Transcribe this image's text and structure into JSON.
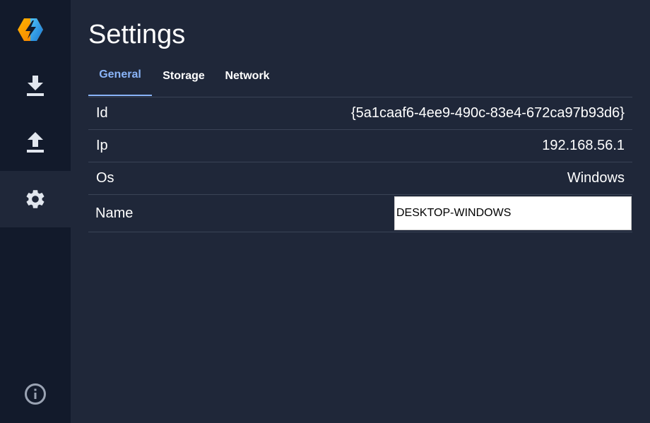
{
  "sidebar": {
    "logo": "lightning-bolt-logo",
    "items": [
      {
        "name": "download",
        "icon": "download-icon"
      },
      {
        "name": "upload",
        "icon": "upload-icon"
      },
      {
        "name": "settings",
        "icon": "gear-icon",
        "active": true
      }
    ],
    "footer_icon": "info-icon"
  },
  "page": {
    "title": "Settings"
  },
  "tabs": [
    {
      "label": "General",
      "active": true
    },
    {
      "label": "Storage",
      "active": false
    },
    {
      "label": "Network",
      "active": false
    }
  ],
  "general": {
    "rows": [
      {
        "label": "Id",
        "value": "{5a1caaf6-4ee9-490c-83e4-672ca97b93d6}"
      },
      {
        "label": "Ip",
        "value": "192.168.56.1"
      },
      {
        "label": "Os",
        "value": "Windows"
      }
    ],
    "name": {
      "label": "Name",
      "value": "DESKTOP-WINDOWS"
    }
  },
  "colors": {
    "background": "#1f2739",
    "sidebar": "#121a2b",
    "accent": "#8ab4f8",
    "divider": "#3a4356",
    "icon": "#e1e6ee"
  }
}
